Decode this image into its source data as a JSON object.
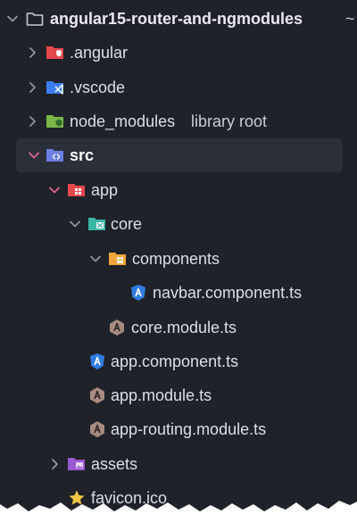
{
  "tree": {
    "root": {
      "label": "angular15-router-and-ngmodules",
      "suffix": "~"
    },
    "angular": {
      "label": ".angular"
    },
    "vscode": {
      "label": ".vscode"
    },
    "node_modules": {
      "label": "node_modules",
      "tag": "library root"
    },
    "src": {
      "label": "src"
    },
    "app": {
      "label": "app"
    },
    "core": {
      "label": "core"
    },
    "components": {
      "label": "components"
    },
    "navbar": {
      "label": "navbar.component.ts"
    },
    "core_module": {
      "label": "core.module.ts"
    },
    "app_component": {
      "label": "app.component.ts"
    },
    "app_module": {
      "label": "app.module.ts"
    },
    "app_routing": {
      "label": "app-routing.module.ts"
    },
    "assets": {
      "label": "assets"
    },
    "favicon": {
      "label": "favicon.ico"
    }
  },
  "colors": {
    "panel_bg": "#1f2229",
    "selection_bg": "#2b2f39",
    "text": "#dcdfe6",
    "chevron": "#8f94a1",
    "chevron_active": "#e2668c",
    "angular_blue": "#2f7de1",
    "module_brown": "#a78b80",
    "folder_red": "#e5484d",
    "folder_blue": "#3d7ff2",
    "folder_green": "#7ab648",
    "folder_violet": "#6b7fe0",
    "folder_teal": "#3bb6a8",
    "folder_orange": "#f0a53a",
    "folder_purple": "#9b59d0",
    "star_yellow": "#f6c744"
  }
}
